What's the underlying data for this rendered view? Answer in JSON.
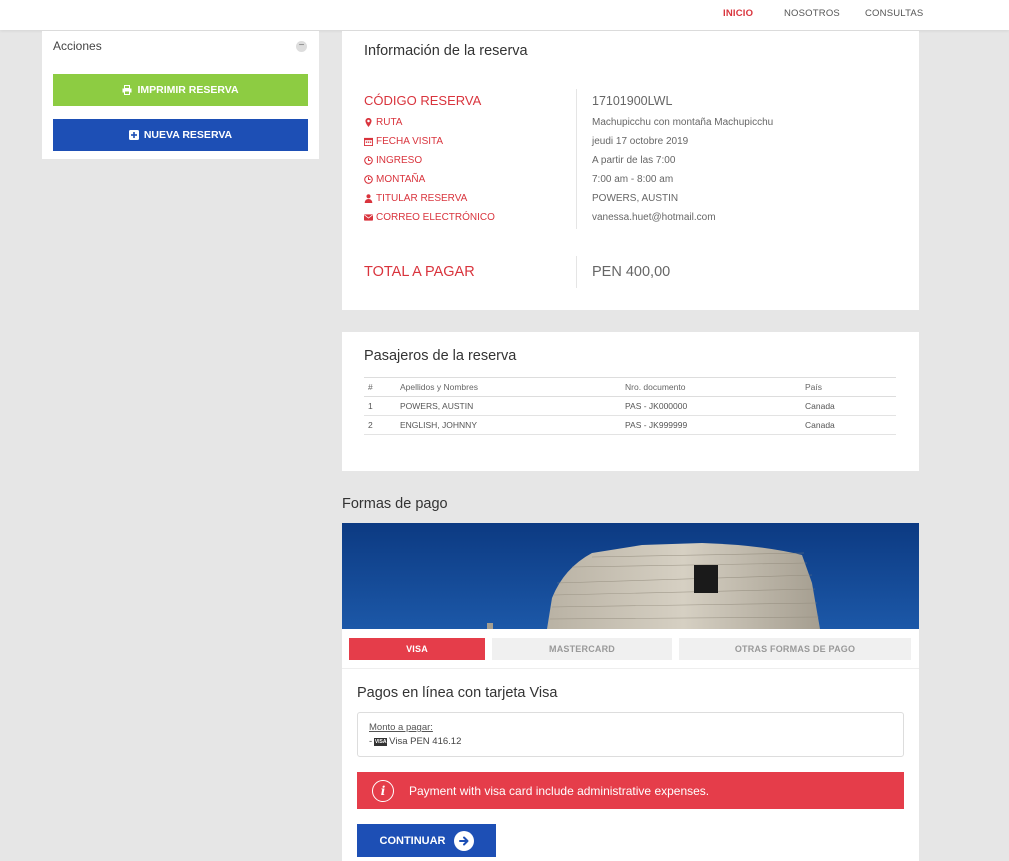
{
  "nav": {
    "inicio": "INICIO",
    "nosotros": "NOSOTROS",
    "consultas": "CONSULTAS"
  },
  "sidebar": {
    "title": "Acciones",
    "collapse_symbol": "−",
    "print_label": "IMPRIMIR RESERVA",
    "new_label": "NUEVA RESERVA"
  },
  "reserva": {
    "title": "Información de la reserva",
    "codigo_label": "CÓDIGO RESERVA",
    "codigo_value": "17101900LWL",
    "ruta_label": "RUTA",
    "ruta_value": "Machupicchu con montaña Machupicchu",
    "fecha_label": "FECHA VISITA",
    "fecha_value": "jeudi 17 octobre 2019",
    "ingreso_label": "INGRESO",
    "ingreso_value": "A partir de las 7:00",
    "montana_label": "MONTAÑA",
    "montana_value": "7:00 am - 8:00 am",
    "titular_label": "TITULAR RESERVA",
    "titular_value": "POWERS, AUSTIN",
    "correo_label": "CORREO ELECTRÓNICO",
    "correo_value": "vanessa.huet@hotmail.com",
    "total_label": "TOTAL A PAGAR",
    "total_value": "PEN 400,00"
  },
  "pasajeros": {
    "title": "Pasajeros de la reserva",
    "headers": [
      "#",
      "Apellidos y Nombres",
      "Nro. documento",
      "País"
    ],
    "rows": [
      [
        "1",
        "POWERS, AUSTIN",
        "PAS - JK000000",
        "Canada"
      ],
      [
        "2",
        "ENGLISH, JOHNNY",
        "PAS - JK999999",
        "Canada"
      ]
    ]
  },
  "pago": {
    "section_title": "Formas de pago",
    "tabs": {
      "visa": "VISA",
      "mastercard": "MASTERCARD",
      "otras": "OTRAS FORMAS DE PAGO"
    },
    "subtitle": "Pagos en línea con tarjeta Visa",
    "monto_label": "Monto a pagar:",
    "monto_prefix": "-",
    "visa_logo_text": "VISA",
    "monto_value": "Visa PEN 416.12",
    "alert_icon": "i",
    "alert_text": "Payment with visa card include administrative expenses.",
    "continuar_label": "CONTINUAR"
  },
  "colors": {
    "accent_red": "#d9343d",
    "brand_blue": "#1d4fb5",
    "print_green": "#8dcc42",
    "alert_red": "#e53d4a"
  }
}
